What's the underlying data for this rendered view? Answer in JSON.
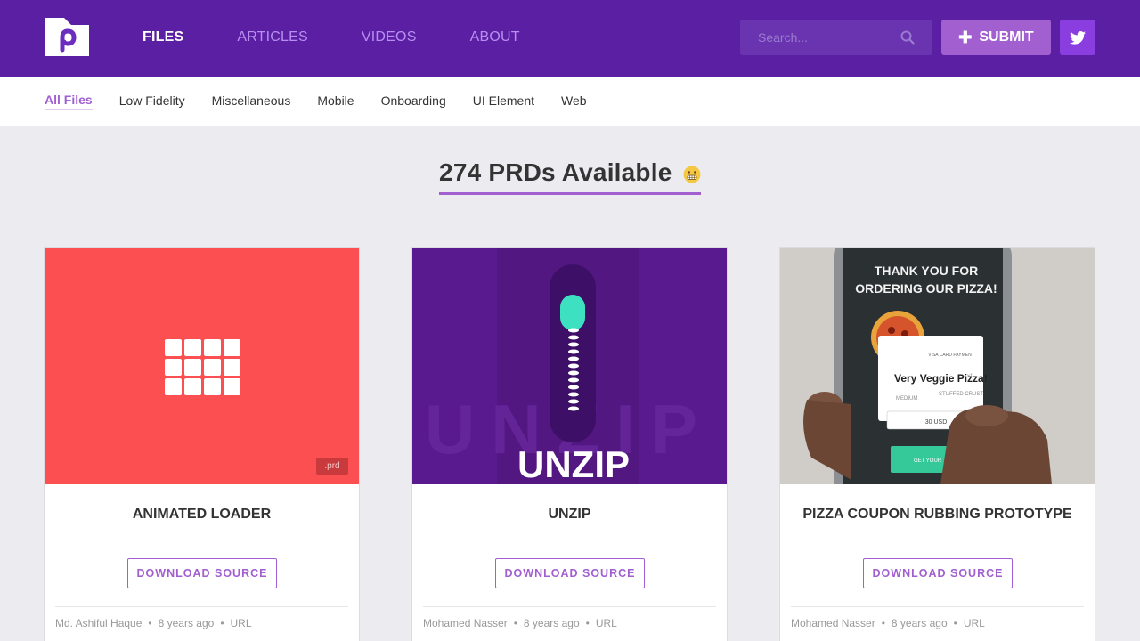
{
  "header": {
    "nav": [
      "FILES",
      "ARTICLES",
      "VIDEOS",
      "ABOUT"
    ],
    "search_placeholder": "Search...",
    "submit_label": "SUBMIT",
    "colors": {
      "bg": "#5b1fa3",
      "accent": "#a15fd0",
      "twitter": "#8a3ee0"
    }
  },
  "subnav": {
    "items": [
      "All Files",
      "Low Fidelity",
      "Miscellaneous",
      "Mobile",
      "Onboarding",
      "UI Element",
      "Web"
    ],
    "active": "All Files"
  },
  "main": {
    "heading": "274 PRDs Available"
  },
  "cards": [
    {
      "title": "ANIMATED LOADER",
      "button": "DOWNLOAD SOURCE",
      "author": "Md. Ashiful Haque",
      "time": "8 years ago",
      "link": "URL",
      "badge": ".prd"
    },
    {
      "title": "UNZIP",
      "button": "DOWNLOAD SOURCE",
      "author": "Mohamed Nasser",
      "time": "8 years ago",
      "link": "URL",
      "thumb_text": "UNZIP"
    },
    {
      "title": "PIZZA COUPON RUBBING PROTOTYPE",
      "button": "DOWNLOAD SOURCE",
      "author": "Mohamed Nasser",
      "time": "8 years ago",
      "link": "URL",
      "thumb_text": {
        "thanks_1": "THANK YOU FOR",
        "thanks_2": "ORDERING OUR PIZZA!",
        "visa": "VISA CARD PAYMENT",
        "item": "Very Veggie Pizza!",
        "qty": "x1",
        "size": "MEDIUM",
        "crust": "STUFFED CRUST",
        "price": "30 USD",
        "cta": "GET YOUR"
      }
    }
  ]
}
